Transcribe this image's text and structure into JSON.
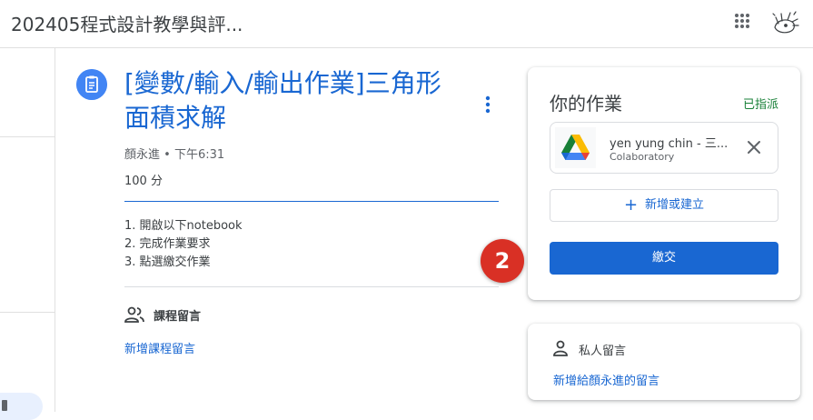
{
  "header": {
    "course_title": "202405程式設計教學與評...",
    "apps_icon": "apps-grid-icon",
    "avatar_icon": "user-avatar-doodle"
  },
  "assignment": {
    "icon": "assignment-icon",
    "title": "[變數/輸入/輸出作業]三角形面積求解",
    "author": "顏永進",
    "separator": "•",
    "posted_time": "下午6:31",
    "points": "100 分",
    "instructions": [
      "1. 開啟以下notebook",
      "2. 完成作業要求",
      "3. 點選繳交作業"
    ]
  },
  "class_comments": {
    "icon": "people-icon",
    "label": "課程留言",
    "add_link": "新增課程留言"
  },
  "step_badge": {
    "number": "2",
    "color": "#d93025"
  },
  "your_work": {
    "title": "你的作業",
    "status": "已指派",
    "attachment": {
      "icon": "google-drive-icon",
      "name": "yen yung chin - 三...",
      "type": "Colaboratory"
    },
    "add_create_label": "新增或建立",
    "submit_label": "繳交"
  },
  "private_comments": {
    "icon": "person-icon",
    "label": "私人留言",
    "add_link": "新增給顏永進的留言"
  },
  "colors": {
    "accent": "#1967d2",
    "status_green": "#188038",
    "icon_blue": "#4285f4"
  }
}
